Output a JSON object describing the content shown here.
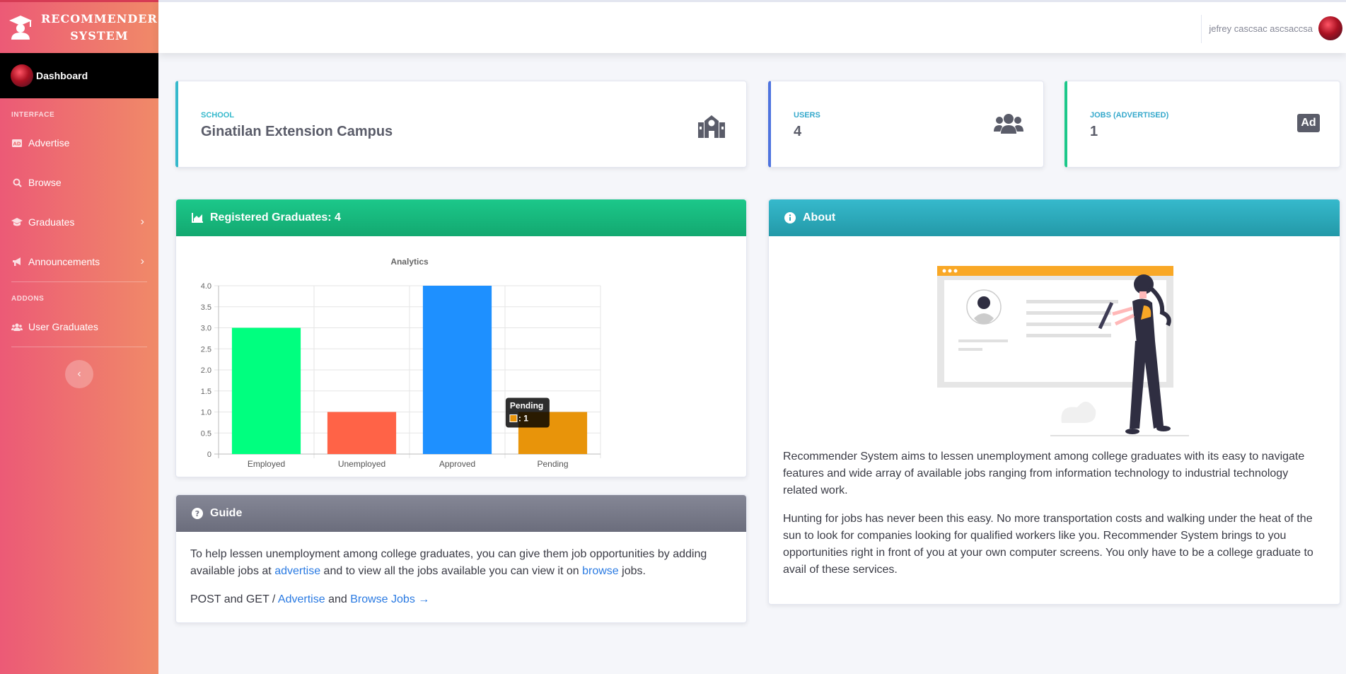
{
  "sidebar": {
    "brand_line1": "RECOMMENDER",
    "brand_line2": "SYSTEM",
    "active_item": "Dashboard",
    "section_interface": "INTERFACE",
    "items": [
      {
        "label": "Advertise",
        "icon": "ad-icon"
      },
      {
        "label": "Browse",
        "icon": "search-icon"
      },
      {
        "label": "Graduates",
        "icon": "graduation-cap-icon"
      },
      {
        "label": "Announcements",
        "icon": "megaphone-icon"
      }
    ],
    "section_addons": "ADDONS",
    "addon_items": [
      {
        "label": "User Graduates",
        "icon": "users-icon"
      }
    ]
  },
  "topbar": {
    "user_name": "jefrey cascsac ascsaccsa"
  },
  "stats": {
    "school": {
      "label": "SCHOOL",
      "value": "Ginatilan Extension Campus",
      "color": "#36b9cc",
      "icon": "school-icon"
    },
    "users": {
      "label": "USERS",
      "value": "4",
      "color": "#4e73df",
      "icon": "users-icon"
    },
    "jobs": {
      "label": "JOBS (ADVERTISED)",
      "value": "1",
      "color": "#1cc88a",
      "icon": "ad-badge-icon",
      "badge_text": "Ad"
    }
  },
  "registered_panel": {
    "title": "Registered Graduates: 4"
  },
  "chart_data": {
    "type": "bar",
    "title": "Analytics",
    "categories": [
      "Employed",
      "Unemployed",
      "Approved",
      "Pending"
    ],
    "values": [
      3,
      1,
      4,
      1
    ],
    "colors": [
      "#00ff7f",
      "#ff6347",
      "#1e90ff",
      "#e8940a"
    ],
    "ylim": [
      0,
      4
    ],
    "yticks": [
      "4.0",
      "3.5",
      "3.0",
      "2.5",
      "2.0",
      "1.5",
      "1.0",
      "0.5",
      "0"
    ],
    "grid": true,
    "tooltip": {
      "title": "Pending",
      "text": ": 1"
    }
  },
  "guide": {
    "title": "Guide",
    "p1_before": "To help lessen unemployment among college graduates, you can give them job opportunities by adding available jobs at ",
    "p1_link1": "advertise",
    "p1_middle": " and to view all the jobs available you can view it on ",
    "p1_link2": "browse",
    "p1_after": " jobs.",
    "p2_before": "POST and GET / ",
    "p2_link1": "Advertise",
    "p2_and": " and ",
    "p2_link2": "Browse Jobs →"
  },
  "about": {
    "title": "About",
    "p1": "Recommender System aims to lessen unemployment among college graduates with its easy to navigate features and wide array of available jobs ranging from information technology to industrial technology related work.",
    "p2": "Hunting for jobs has never been this easy. No more transportation costs and walking under the heat of the sun to look for companies looking for qualified workers like you. Recommender System brings to you opportunities right in front of you at your own computer screens. You only have to be a college graduate to avail of these services."
  }
}
